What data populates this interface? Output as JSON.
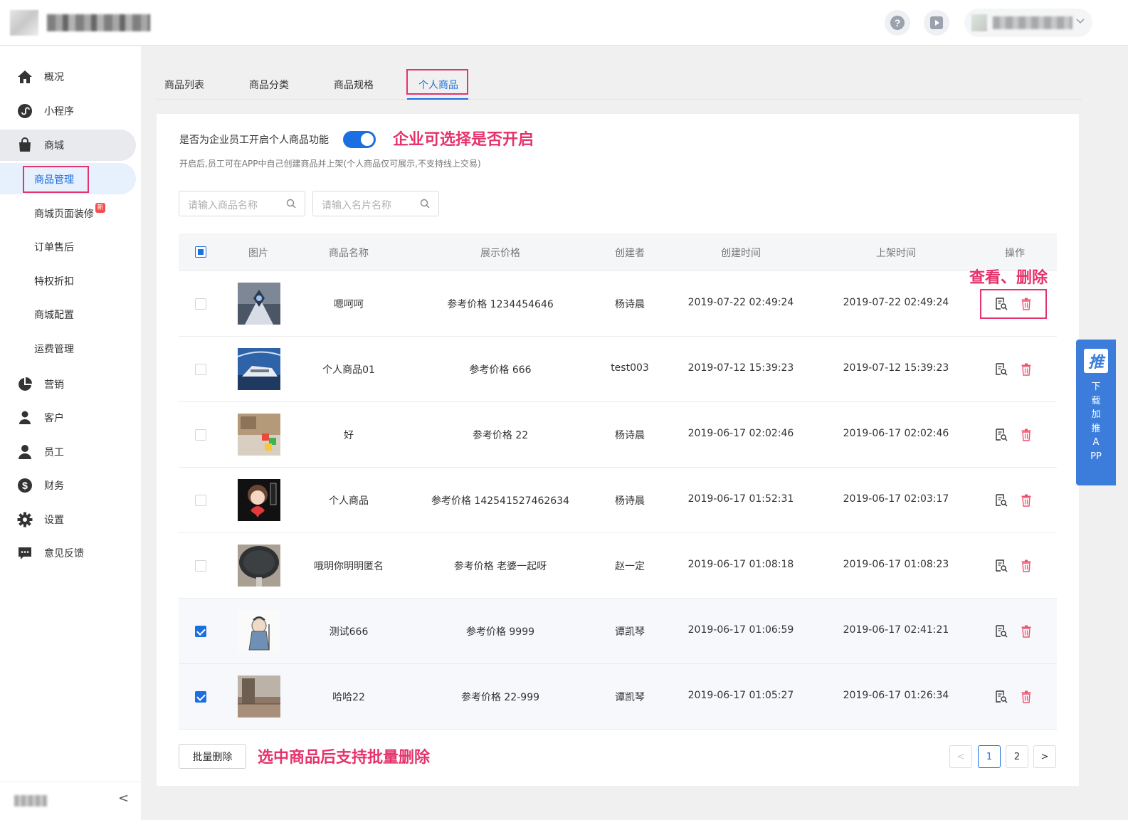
{
  "nav": {
    "items": [
      {
        "label": "概况",
        "icon": "home-icon"
      },
      {
        "label": "小程序",
        "icon": "mini-program-icon"
      },
      {
        "label": "商城",
        "icon": "shopping-bag-icon"
      },
      {
        "label": "营销",
        "icon": "pie-chart-icon"
      },
      {
        "label": "客户",
        "icon": "customer-icon"
      },
      {
        "label": "员工",
        "icon": "employee-icon"
      },
      {
        "label": "财务",
        "icon": "dollar-icon"
      },
      {
        "label": "设置",
        "icon": "gear-icon"
      },
      {
        "label": "意见反馈",
        "icon": "feedback-icon"
      }
    ],
    "mall_sub": [
      {
        "label": "商品管理"
      },
      {
        "label": "商城页面装修",
        "badge": "新"
      },
      {
        "label": "订单售后"
      },
      {
        "label": "特权折扣"
      },
      {
        "label": "商城配置"
      },
      {
        "label": "运费管理"
      }
    ]
  },
  "tabs": [
    "商品列表",
    "商品分类",
    "商品规格",
    "个人商品"
  ],
  "settings": {
    "switch_label": "是否为企业员工开启个人商品功能",
    "switch_on": true,
    "hint": "开启后,员工可在APP中自己创建商品并上架(个人商品仅可展示,不支持线上交易)"
  },
  "search": {
    "product_placeholder": "请输入商品名称",
    "card_placeholder": "请输入名片名称"
  },
  "table": {
    "columns": [
      "图片",
      "商品名称",
      "展示价格",
      "创建者",
      "创建时间",
      "上架时间",
      "操作"
    ],
    "rows": [
      {
        "name": "嗯呵呵",
        "price": "参考价格 1234454646",
        "creator": "杨诗晨",
        "created": "2019-07-22 02:49:24",
        "listed": "2019-07-22 02:49:24",
        "checked": false
      },
      {
        "name": "个人商品01",
        "price": "参考价格 666",
        "creator": "test003",
        "created": "2019-07-12 15:39:23",
        "listed": "2019-07-12 15:39:23",
        "checked": false
      },
      {
        "name": "好",
        "price": "参考价格 22",
        "creator": "杨诗晨",
        "created": "2019-06-17 02:02:46",
        "listed": "2019-06-17 02:02:46",
        "checked": false
      },
      {
        "name": "个人商品",
        "price": "参考价格 142541527462634",
        "creator": "杨诗晨",
        "created": "2019-06-17 01:52:31",
        "listed": "2019-06-17 02:03:17",
        "checked": false
      },
      {
        "name": "哦明你明明匿名",
        "price": "参考价格 老婆一起呀",
        "creator": "赵一定",
        "created": "2019-06-17 01:08:18",
        "listed": "2019-06-17 01:08:23",
        "checked": false
      },
      {
        "name": "测试666",
        "price": "参考价格 9999",
        "creator": "谭凯琴",
        "created": "2019-06-17 01:06:59",
        "listed": "2019-06-17 02:41:21",
        "checked": true
      },
      {
        "name": "哈哈22",
        "price": "参考价格 22-999",
        "creator": "谭凯琴",
        "created": "2019-06-17 01:05:27",
        "listed": "2019-06-17 01:26:34",
        "checked": true
      }
    ]
  },
  "batch_delete_label": "批量删除",
  "pagination": {
    "pages": [
      "1",
      "2"
    ],
    "current": "1",
    "prev": "<",
    "next": ">"
  },
  "annotations": {
    "switch_note": "企业可选择是否开启",
    "ops_note": "查看、删除",
    "batch_note": "选中商品后支持批量删除"
  },
  "float_app": {
    "badge": "推",
    "text": "下载加推APP"
  },
  "sidebar_collapse": "<",
  "colors": {
    "accent": "#1b6fe0",
    "annotation": "#e5336b",
    "danger": "#f0506e",
    "float": "#3c7ddb"
  }
}
